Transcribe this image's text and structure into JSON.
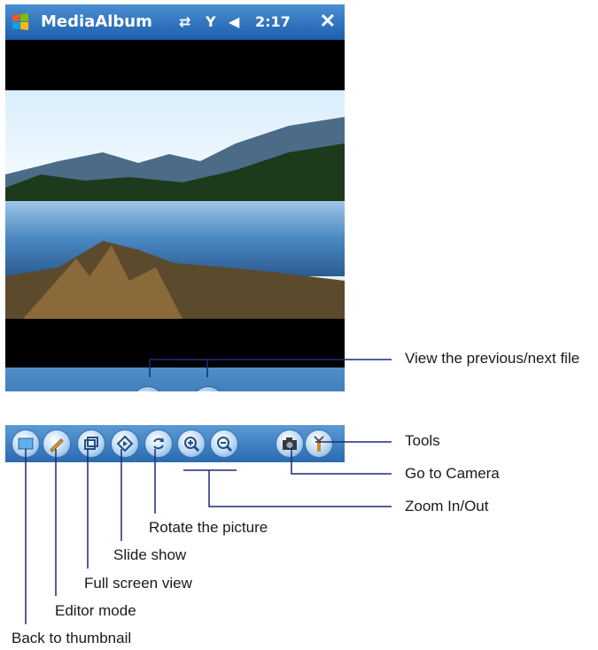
{
  "window": {
    "title": "MediaAlbum",
    "time": "2:17",
    "close_label": "✕"
  },
  "callouts": {
    "prev_next": "View the previous/next file",
    "tools": "Tools",
    "camera": "Go to Camera",
    "zoom": "Zoom In/Out",
    "rotate": "Rotate the picture",
    "slideshow": "Slide show",
    "fullscreen": "Full screen view",
    "editor": "Editor mode",
    "thumbnail": "Back to thumbnail"
  },
  "colors": {
    "titlebar": "#2b6cb6",
    "toolbar": "#3c7ec4",
    "callout_line": "#1c2a7a"
  },
  "icons": [
    "windows-logo-icon",
    "connectivity-icon",
    "signal-icon",
    "volume-icon",
    "close-icon",
    "previous-icon",
    "next-icon",
    "thumbnail-icon",
    "edit-icon",
    "fullscreen-icon",
    "slideshow-icon",
    "rotate-icon",
    "zoom-in-icon",
    "zoom-out-icon",
    "camera-icon",
    "tools-icon"
  ]
}
